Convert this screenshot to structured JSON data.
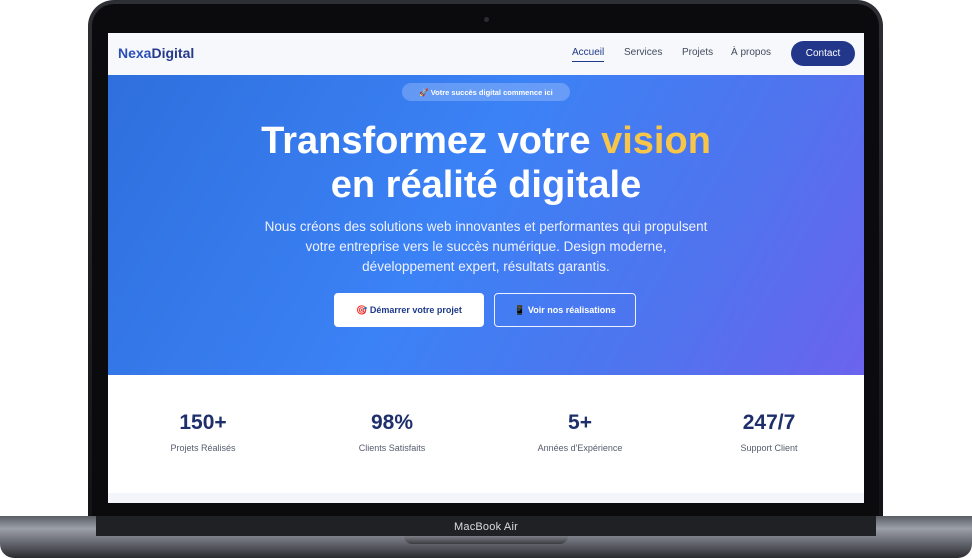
{
  "device": {
    "label": "MacBook Air"
  },
  "nav": {
    "brand_part1": "Nexa",
    "brand_part2": "Digital",
    "links": [
      "Accueil",
      "Services",
      "Projets",
      "À propos"
    ],
    "cta": "Contact"
  },
  "hero": {
    "badge_icon": "rocket-icon",
    "badge": "🚀 Votre succès digital commence ici",
    "title_line1_a": "Transformez votre ",
    "title_line1_highlight": "vision",
    "title_line2": "en réalité digitale",
    "subtitle": "Nous créons des solutions web innovantes et performantes qui propulsent votre entreprise vers le succès numérique. Design moderne, développement expert, résultats garantis.",
    "primary_button": "🎯 Démarrer votre projet",
    "secondary_button": "📱 Voir nos réalisations"
  },
  "stats": [
    {
      "value": "150+",
      "label": "Projets Réalisés"
    },
    {
      "value": "98%",
      "label": "Clients Satisfaits"
    },
    {
      "value": "5+",
      "label": "Années d'Expérience"
    },
    {
      "value": "247/7",
      "label": "Support Client"
    }
  ],
  "colors": {
    "accent": "#22378a",
    "highlight": "#f7c548",
    "hero_start": "#2f6fdd",
    "hero_end": "#6b63ee"
  }
}
